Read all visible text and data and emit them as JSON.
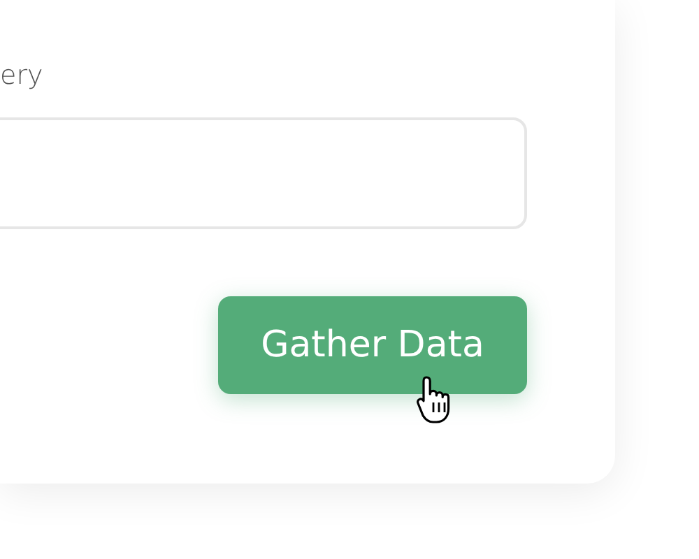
{
  "form": {
    "field_label": "ery",
    "submit_button": "Gather Data"
  }
}
